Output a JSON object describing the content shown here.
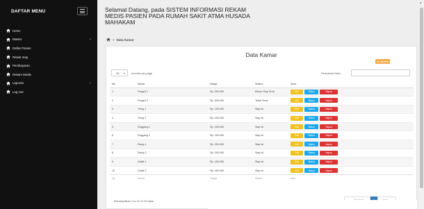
{
  "sidebar": {
    "title": "DAFTAR MENU",
    "items": [
      {
        "label": "Home",
        "has_chevron": false
      },
      {
        "label": "Master",
        "has_chevron": true
      },
      {
        "label": "Daftar Pasien",
        "has_chevron": false
      },
      {
        "label": "Rawat Inap",
        "has_chevron": false
      },
      {
        "label": "Pembayaran",
        "has_chevron": false
      },
      {
        "label": "Rekam Medis",
        "has_chevron": false
      },
      {
        "label": "Laporan",
        "has_chevron": true
      },
      {
        "label": "Log Out",
        "has_chevron": false
      }
    ],
    "icon": "home-icon",
    "background": "#111111"
  },
  "header": {
    "welcome": "Selamat Datang, pada SISTEM INFORMASI REKAM MEDIS PASIEN PADA RUMAH SAKIT ATMA HUSADA MAHAKAM"
  },
  "breadcrumb": {
    "separator": ">",
    "current": "Data Kamar"
  },
  "panel": {
    "title": "Data Kamar",
    "add_button": "Tambah",
    "length_value": "10",
    "length_label": "records per page",
    "search_label": "Pencarian Data :",
    "search_value": ""
  },
  "table": {
    "columns": [
      "No",
      "Nama",
      "Harga",
      "Status",
      "Aksi"
    ],
    "rows": [
      {
        "no": "1",
        "nama": "Pergeri 1",
        "harga": "Rp. 500.000",
        "status": "Belum Siap Di Isi"
      },
      {
        "no": "2",
        "nama": "Pergeri 2",
        "harga": "Rp. 500.000",
        "status": "Telah Terisi"
      },
      {
        "no": "3",
        "nama": "Tiung 1",
        "harga": "Rp. 150.000",
        "status": "Siap Isi"
      },
      {
        "no": "4",
        "nama": "Tiung 2",
        "harga": "Rp. 150.000",
        "status": "Siap Isi"
      },
      {
        "no": "5",
        "nama": "Enggang 1",
        "harga": "Rp. 200.000",
        "status": "Siap Isi"
      },
      {
        "no": "6",
        "nama": "Enggang 2",
        "harga": "Rp. 200.000",
        "status": "Siap Isi"
      },
      {
        "no": "7",
        "nama": "Elang 1",
        "harga": "Rp. 300.000",
        "status": "Siap Isi"
      },
      {
        "no": "8",
        "nama": "Elang 2",
        "harga": "Rp. 300.000",
        "status": "Siap Isi"
      },
      {
        "no": "9",
        "nama": "Glatik 1",
        "harga": "Rp. 400.000",
        "status": "Siap Isi"
      },
      {
        "no": "10",
        "nama": "Glatik 2",
        "harga": "Rp. 400.000",
        "status": "Siap Isi"
      }
    ],
    "actions": {
      "edit": "Edit",
      "status": "Status",
      "hapus": "Hapus"
    }
  },
  "footer": {
    "info": "Menampilkan 1 to 10 of 10 Data",
    "prev": "← Previous",
    "page": "1",
    "next": "Next →"
  },
  "colors": {
    "accent_primary": "#337ab7",
    "btn_edit": "#f0c020",
    "btn_status": "#1ea7e8",
    "btn_hapus": "#dd3333",
    "btn_tambah": "#f0ad4e"
  }
}
